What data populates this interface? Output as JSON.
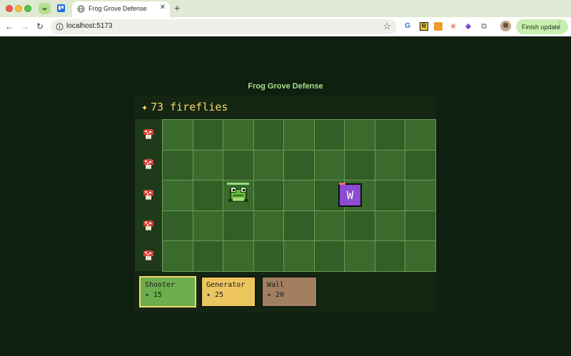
{
  "browser": {
    "tab_title": "Frog Grove Defense",
    "url": "localhost:5173",
    "finish_update_label": "Finish update"
  },
  "game": {
    "title": "Frog Grove Defense",
    "currency_icon": "✦",
    "currency_text": "73 fireflies",
    "lanes": 5,
    "columns": 9,
    "units": [
      {
        "type": "frog-shooter",
        "row": 3,
        "col": 3
      },
      {
        "type": "wall",
        "label": "W",
        "row": 3,
        "col": 7
      }
    ],
    "cards": [
      {
        "name": "Shooter",
        "cost": "✦ 15",
        "selected": true,
        "color": "#6dad4d"
      },
      {
        "name": "Generator",
        "cost": "✦ 25",
        "selected": false,
        "color": "#edc55f"
      },
      {
        "name": "Wall",
        "cost": "✦ 20",
        "selected": false,
        "color": "#a27f60"
      }
    ]
  }
}
